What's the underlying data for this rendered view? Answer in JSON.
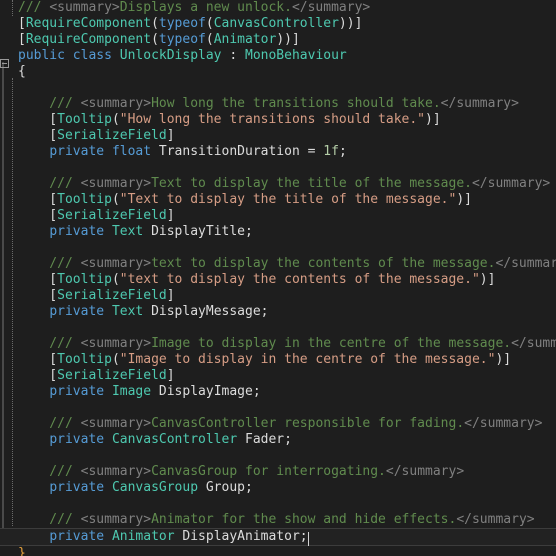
{
  "editor": {
    "language": "csharp",
    "theme": "dark",
    "background_color": "#1e1e1e",
    "current_line_color": "#222222",
    "font_size_px": 13,
    "line_height_px": 16,
    "colors": {
      "comment": "#57a64a",
      "doc_comment": "#608b4e",
      "xml_doc_tag": "#808080",
      "keyword": "#569cd6",
      "type": "#4ec9b0",
      "identifier": "#dcdcdc",
      "string": "#d69d85",
      "number": "#b5cea8",
      "punctuation": "#dcdcdc",
      "brace_highlight": "#e8a33d",
      "guide_line": "#6b6b6b",
      "fold_marker": "#9a9a9a"
    }
  },
  "gutter": {
    "fold_marker_label": "collapse",
    "fold_marker_state": "expanded"
  },
  "caret": {
    "line_index": 33,
    "column_text": "        private Animator DisplayAnimator;"
  },
  "code": {
    "lines": [
      {
        "i": 0,
        "indent": 1,
        "tokens": [
          {
            "t": "/// ",
            "c": "cmtdoc"
          },
          {
            "t": "<summary>",
            "c": "xmltag"
          },
          {
            "t": "Displays a new unlock.",
            "c": "cmtdoc"
          },
          {
            "t": "</summary>",
            "c": "xmltag"
          }
        ]
      },
      {
        "i": 1,
        "indent": 1,
        "tokens": [
          {
            "t": "[",
            "c": "punc"
          },
          {
            "t": "RequireComponent",
            "c": "type"
          },
          {
            "t": "(",
            "c": "punc"
          },
          {
            "t": "typeof",
            "c": "kw"
          },
          {
            "t": "(",
            "c": "punc"
          },
          {
            "t": "CanvasController",
            "c": "type"
          },
          {
            "t": "))]",
            "c": "punc"
          }
        ]
      },
      {
        "i": 2,
        "indent": 1,
        "tokens": [
          {
            "t": "[",
            "c": "punc"
          },
          {
            "t": "RequireComponent",
            "c": "type"
          },
          {
            "t": "(",
            "c": "punc"
          },
          {
            "t": "typeof",
            "c": "kw"
          },
          {
            "t": "(",
            "c": "punc"
          },
          {
            "t": "Animator",
            "c": "type"
          },
          {
            "t": "))]",
            "c": "punc"
          }
        ]
      },
      {
        "i": 3,
        "indent": 0,
        "fold": true,
        "tokens": [
          {
            "t": "public",
            "c": "kw"
          },
          {
            "t": " ",
            "c": "plain"
          },
          {
            "t": "class",
            "c": "kw"
          },
          {
            "t": " ",
            "c": "plain"
          },
          {
            "t": "UnlockDisplay",
            "c": "type"
          },
          {
            "t": " : ",
            "c": "plain"
          },
          {
            "t": "MonoBehaviour",
            "c": "type"
          }
        ]
      },
      {
        "i": 4,
        "indent": 0,
        "tokens": [
          {
            "t": "{",
            "c": "punc"
          }
        ]
      },
      {
        "i": 5,
        "indent": 1,
        "tokens": []
      },
      {
        "i": 6,
        "indent": 1,
        "tokens": [
          {
            "t": "    /// ",
            "c": "cmtdoc"
          },
          {
            "t": "<summary>",
            "c": "xmltag"
          },
          {
            "t": "How long the transitions should take.",
            "c": "cmtdoc"
          },
          {
            "t": "</summary>",
            "c": "xmltag"
          }
        ]
      },
      {
        "i": 7,
        "indent": 1,
        "tokens": [
          {
            "t": "    [",
            "c": "punc"
          },
          {
            "t": "Tooltip",
            "c": "type"
          },
          {
            "t": "(",
            "c": "punc"
          },
          {
            "t": "\"How long the transitions should take.\"",
            "c": "str"
          },
          {
            "t": ")]",
            "c": "punc"
          }
        ]
      },
      {
        "i": 8,
        "indent": 1,
        "tokens": [
          {
            "t": "    [",
            "c": "punc"
          },
          {
            "t": "SerializeField",
            "c": "type"
          },
          {
            "t": "]",
            "c": "punc"
          }
        ]
      },
      {
        "i": 9,
        "indent": 1,
        "tokens": [
          {
            "t": "    ",
            "c": "plain"
          },
          {
            "t": "private",
            "c": "kw"
          },
          {
            "t": " ",
            "c": "plain"
          },
          {
            "t": "float",
            "c": "kw"
          },
          {
            "t": " ",
            "c": "plain"
          },
          {
            "t": "TransitionDuration",
            "c": "ident"
          },
          {
            "t": " = ",
            "c": "plain"
          },
          {
            "t": "1f",
            "c": "num"
          },
          {
            "t": ";",
            "c": "punc"
          }
        ]
      },
      {
        "i": 10,
        "indent": 1,
        "tokens": []
      },
      {
        "i": 11,
        "indent": 1,
        "tokens": [
          {
            "t": "    /// ",
            "c": "cmtdoc"
          },
          {
            "t": "<summary>",
            "c": "xmltag"
          },
          {
            "t": "Text to display the title of the message.",
            "c": "cmtdoc"
          },
          {
            "t": "</summary>",
            "c": "xmltag"
          }
        ]
      },
      {
        "i": 12,
        "indent": 1,
        "tokens": [
          {
            "t": "    [",
            "c": "punc"
          },
          {
            "t": "Tooltip",
            "c": "type"
          },
          {
            "t": "(",
            "c": "punc"
          },
          {
            "t": "\"Text to display the title of the message.\"",
            "c": "str"
          },
          {
            "t": ")]",
            "c": "punc"
          }
        ]
      },
      {
        "i": 13,
        "indent": 1,
        "tokens": [
          {
            "t": "    [",
            "c": "punc"
          },
          {
            "t": "SerializeField",
            "c": "type"
          },
          {
            "t": "]",
            "c": "punc"
          }
        ]
      },
      {
        "i": 14,
        "indent": 1,
        "tokens": [
          {
            "t": "    ",
            "c": "plain"
          },
          {
            "t": "private",
            "c": "kw"
          },
          {
            "t": " ",
            "c": "plain"
          },
          {
            "t": "Text",
            "c": "type"
          },
          {
            "t": " ",
            "c": "plain"
          },
          {
            "t": "DisplayTitle",
            "c": "ident"
          },
          {
            "t": ";",
            "c": "punc"
          }
        ]
      },
      {
        "i": 15,
        "indent": 1,
        "tokens": []
      },
      {
        "i": 16,
        "indent": 1,
        "tokens": [
          {
            "t": "    /// ",
            "c": "cmtdoc"
          },
          {
            "t": "<summary>",
            "c": "xmltag"
          },
          {
            "t": "text to display the contents of the message.",
            "c": "cmtdoc"
          },
          {
            "t": "</summary>",
            "c": "xmltag"
          }
        ]
      },
      {
        "i": 17,
        "indent": 1,
        "tokens": [
          {
            "t": "    [",
            "c": "punc"
          },
          {
            "t": "Tooltip",
            "c": "type"
          },
          {
            "t": "(",
            "c": "punc"
          },
          {
            "t": "\"text to display the contents of the message.\"",
            "c": "str"
          },
          {
            "t": ")]",
            "c": "punc"
          }
        ]
      },
      {
        "i": 18,
        "indent": 1,
        "tokens": [
          {
            "t": "    [",
            "c": "punc"
          },
          {
            "t": "SerializeField",
            "c": "type"
          },
          {
            "t": "]",
            "c": "punc"
          }
        ]
      },
      {
        "i": 19,
        "indent": 1,
        "tokens": [
          {
            "t": "    ",
            "c": "plain"
          },
          {
            "t": "private",
            "c": "kw"
          },
          {
            "t": " ",
            "c": "plain"
          },
          {
            "t": "Text",
            "c": "type"
          },
          {
            "t": " ",
            "c": "plain"
          },
          {
            "t": "DisplayMessage",
            "c": "ident"
          },
          {
            "t": ";",
            "c": "punc"
          }
        ]
      },
      {
        "i": 20,
        "indent": 1,
        "tokens": []
      },
      {
        "i": 21,
        "indent": 1,
        "tokens": [
          {
            "t": "    /// ",
            "c": "cmtdoc"
          },
          {
            "t": "<summary>",
            "c": "xmltag"
          },
          {
            "t": "Image to display in the centre of the message.",
            "c": "cmtdoc"
          },
          {
            "t": "</summary>",
            "c": "xmltag"
          }
        ]
      },
      {
        "i": 22,
        "indent": 1,
        "tokens": [
          {
            "t": "    [",
            "c": "punc"
          },
          {
            "t": "Tooltip",
            "c": "type"
          },
          {
            "t": "(",
            "c": "punc"
          },
          {
            "t": "\"Image to display in the centre of the message.\"",
            "c": "str"
          },
          {
            "t": ")]",
            "c": "punc"
          }
        ]
      },
      {
        "i": 23,
        "indent": 1,
        "tokens": [
          {
            "t": "    [",
            "c": "punc"
          },
          {
            "t": "SerializeField",
            "c": "type"
          },
          {
            "t": "]",
            "c": "punc"
          }
        ]
      },
      {
        "i": 24,
        "indent": 1,
        "tokens": [
          {
            "t": "    ",
            "c": "plain"
          },
          {
            "t": "private",
            "c": "kw"
          },
          {
            "t": " ",
            "c": "plain"
          },
          {
            "t": "Image",
            "c": "type"
          },
          {
            "t": " ",
            "c": "plain"
          },
          {
            "t": "DisplayImage",
            "c": "ident"
          },
          {
            "t": ";",
            "c": "punc"
          }
        ]
      },
      {
        "i": 25,
        "indent": 1,
        "tokens": []
      },
      {
        "i": 26,
        "indent": 1,
        "tokens": [
          {
            "t": "    /// ",
            "c": "cmtdoc"
          },
          {
            "t": "<summary>",
            "c": "xmltag"
          },
          {
            "t": "CanvasController responsible for fading.",
            "c": "cmtdoc"
          },
          {
            "t": "</summary>",
            "c": "xmltag"
          }
        ]
      },
      {
        "i": 27,
        "indent": 1,
        "tokens": [
          {
            "t": "    ",
            "c": "plain"
          },
          {
            "t": "private",
            "c": "kw"
          },
          {
            "t": " ",
            "c": "plain"
          },
          {
            "t": "CanvasController",
            "c": "type"
          },
          {
            "t": " ",
            "c": "plain"
          },
          {
            "t": "Fader",
            "c": "ident"
          },
          {
            "t": ";",
            "c": "punc"
          }
        ]
      },
      {
        "i": 28,
        "indent": 1,
        "tokens": []
      },
      {
        "i": 29,
        "indent": 1,
        "tokens": [
          {
            "t": "    /// ",
            "c": "cmtdoc"
          },
          {
            "t": "<summary>",
            "c": "xmltag"
          },
          {
            "t": "CanvasGroup for interrogating.",
            "c": "cmtdoc"
          },
          {
            "t": "</summary>",
            "c": "xmltag"
          }
        ]
      },
      {
        "i": 30,
        "indent": 1,
        "tokens": [
          {
            "t": "    ",
            "c": "plain"
          },
          {
            "t": "private",
            "c": "kw"
          },
          {
            "t": " ",
            "c": "plain"
          },
          {
            "t": "CanvasGroup",
            "c": "type"
          },
          {
            "t": " ",
            "c": "plain"
          },
          {
            "t": "Group",
            "c": "ident"
          },
          {
            "t": ";",
            "c": "punc"
          }
        ]
      },
      {
        "i": 31,
        "indent": 1,
        "tokens": []
      },
      {
        "i": 32,
        "indent": 1,
        "tokens": [
          {
            "t": "    /// ",
            "c": "cmtdoc"
          },
          {
            "t": "<summary>",
            "c": "xmltag"
          },
          {
            "t": "Animator for the show and hide effects.",
            "c": "cmtdoc"
          },
          {
            "t": "</summary>",
            "c": "xmltag"
          }
        ]
      },
      {
        "i": 33,
        "indent": 1,
        "current": true,
        "caret_after": true,
        "tokens": [
          {
            "t": "    ",
            "c": "plain"
          },
          {
            "t": "private",
            "c": "kw"
          },
          {
            "t": " ",
            "c": "plain"
          },
          {
            "t": "Animator",
            "c": "type"
          },
          {
            "t": " ",
            "c": "plain"
          },
          {
            "t": "DisplayAnimator",
            "c": "ident"
          },
          {
            "t": ";",
            "c": "punc"
          }
        ]
      },
      {
        "i": 34,
        "indent": 0,
        "tokens": [
          {
            "t": "}",
            "c": "brace-gold"
          }
        ]
      }
    ]
  }
}
